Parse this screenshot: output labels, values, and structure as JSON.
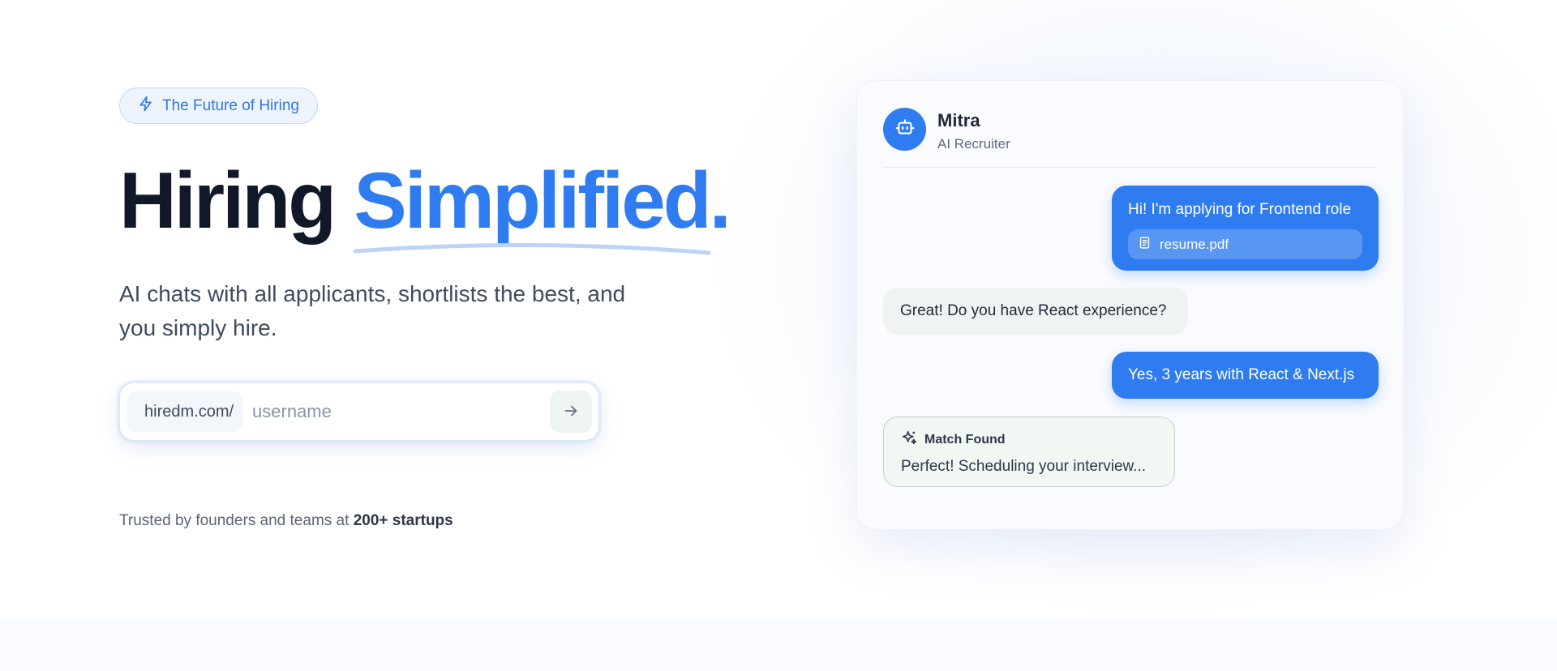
{
  "badge": {
    "label": "The Future of Hiring",
    "icon": "lightning-icon"
  },
  "headline": {
    "part1": "Hiring",
    "part2": "Simplified."
  },
  "subtitle": "AI chats with all applicants, shortlists the best, and you simply hire.",
  "signup": {
    "prefix": "hiredm.com/",
    "placeholder": "username",
    "value": "",
    "submit_icon": "arrow-right-icon"
  },
  "trust": {
    "text": "Trusted by founders and teams at",
    "highlight": "200+ startups"
  },
  "chat": {
    "bot_name": "Mitra",
    "bot_role": "AI Recruiter",
    "messages": [
      {
        "from": "user",
        "text": "Hi! I'm applying for Frontend role",
        "attachment": "resume.pdf"
      },
      {
        "from": "bot",
        "text": "Great! Do you have React experience?"
      },
      {
        "from": "user",
        "text": "Yes, 3 years with React & Next.js"
      }
    ],
    "match": {
      "title": "Match Found",
      "text": "Perfect! Scheduling your interview..."
    }
  },
  "colors": {
    "accent": "#2f7cf0",
    "heading": "#111827",
    "match_bg": "#f1f8f4"
  }
}
